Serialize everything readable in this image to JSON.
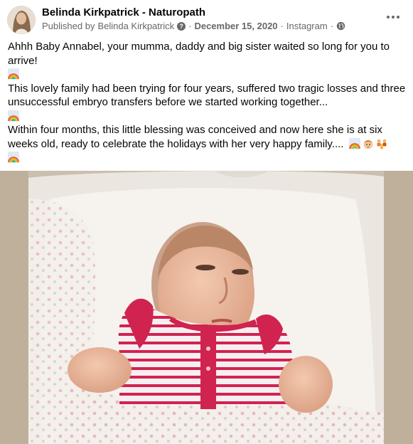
{
  "post": {
    "author": "Belinda Kirkpatrick - Naturopath",
    "published_prefix": "Published by",
    "publisher": "Belinda Kirkpatrick",
    "date": "December 15, 2020",
    "source": "Instagram",
    "separator": "·",
    "help_glyph": "?",
    "paragraph_1": "Ahhh Baby Annabel, your  mumma, daddy and big sister waited so long for you to arrive!",
    "paragraph_2": "This lovely family had been trying for four years, suffered two tragic losses and three unsuccessful embryo transfers before we started working together...",
    "paragraph_3": "Within four months, this little blessing was conceived and now here she is at six weeks old, ready to celebrate the holidays with her very happy family....",
    "icons": {
      "avatar": "avatar",
      "help": "question-icon",
      "audience": "globe-icon",
      "more": "more-icon",
      "rainbow": "rainbow-icon",
      "baby": "baby-icon",
      "family": "family-icon"
    }
  },
  "colors": {
    "text": "#050505",
    "secondary": "#65676b",
    "background": "#ffffff"
  }
}
